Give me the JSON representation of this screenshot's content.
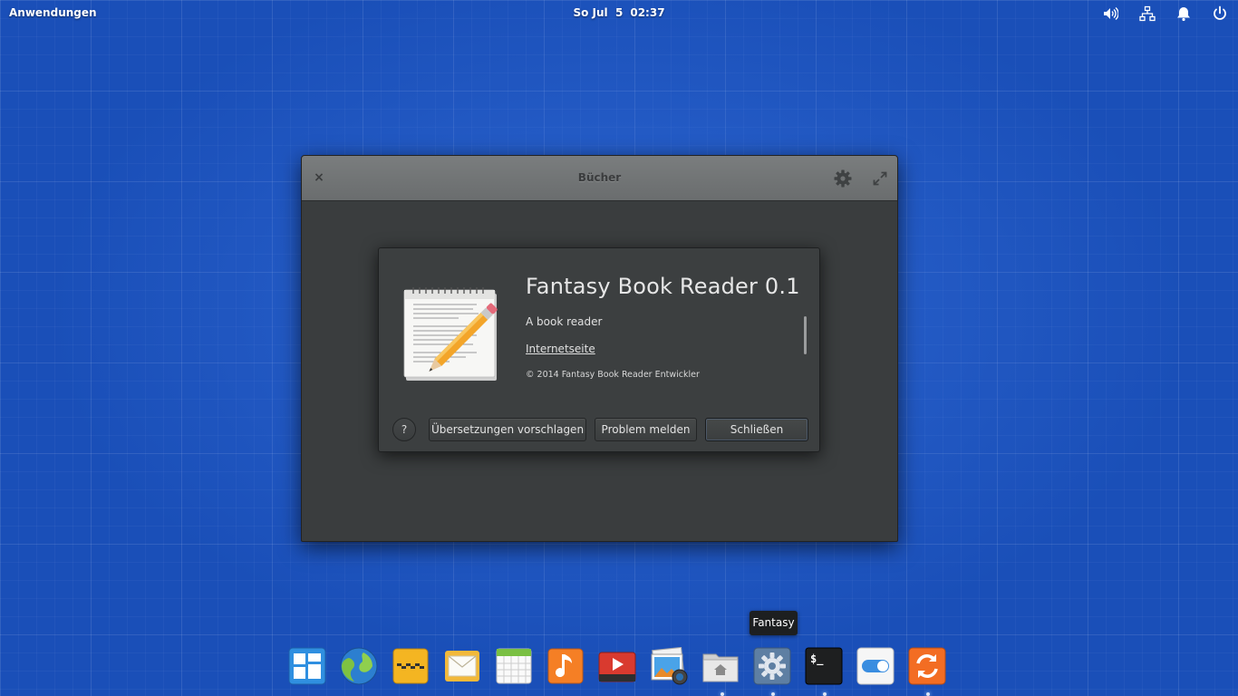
{
  "panel": {
    "applications_label": "Anwendungen",
    "date": "So Jul  5",
    "time": "02:37",
    "indicators": [
      "volume-icon",
      "network-icon",
      "notifications-icon",
      "power-icon"
    ]
  },
  "window": {
    "title": "Bücher",
    "close_glyph": "×"
  },
  "about": {
    "name": "Fantasy Book Reader 0.1",
    "description": "A book reader",
    "website_label": "Internetseite",
    "copyright": "© 2014 Fantasy Book Reader Entwickler",
    "help_glyph": "?",
    "translate_button": "Übersetzungen vorschlagen",
    "report_button": "Problem melden",
    "close_button": "Schließen"
  },
  "dock": {
    "tooltip": "Fantasy",
    "items": [
      "multitasking-view-icon",
      "web-browser-icon",
      "taxi-icon",
      "mail-icon",
      "calendar-icon",
      "music-icon",
      "videos-icon",
      "photos-icon",
      "files-icon",
      "settings-icon",
      "terminal-icon",
      "switchboard-icon",
      "updates-icon"
    ]
  },
  "colors": {
    "desktop": "#1a4fb8",
    "window_body": "#3a3d3e",
    "titlebar": "#6f7273",
    "dialog": "#3c3f40"
  }
}
